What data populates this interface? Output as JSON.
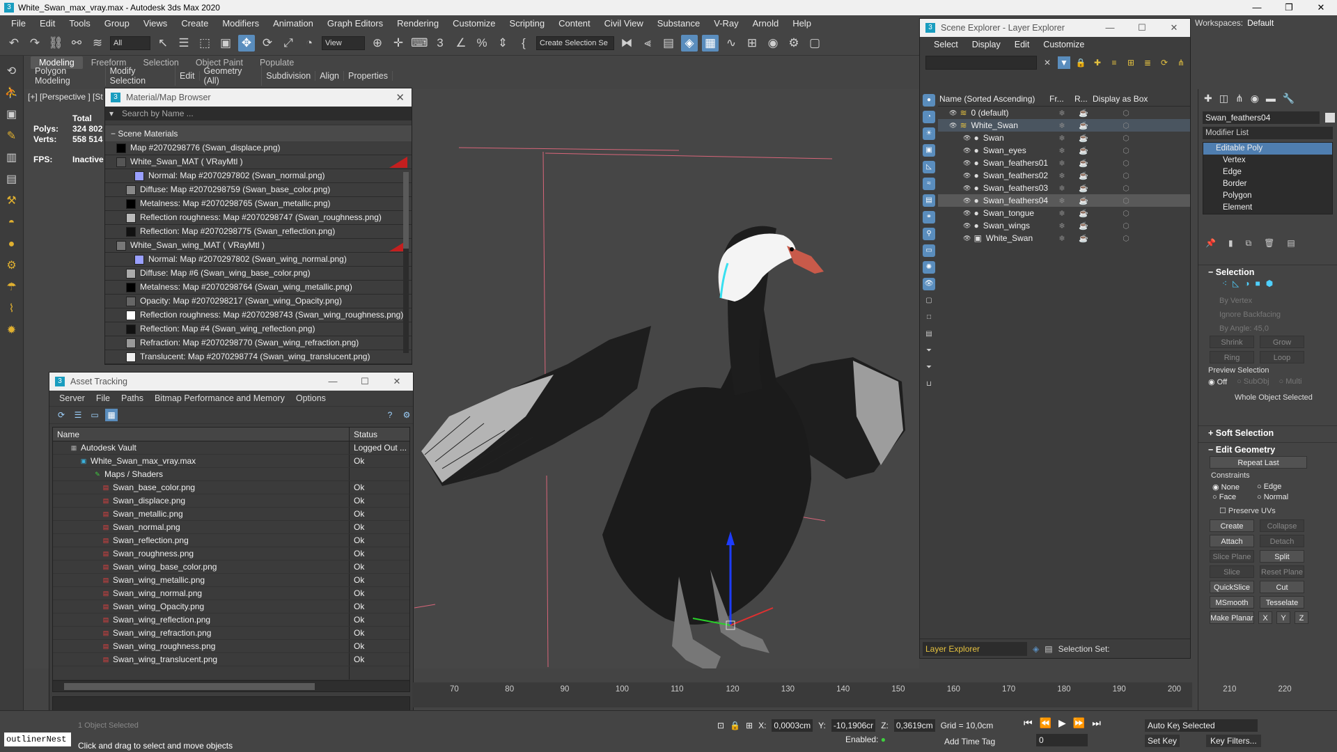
{
  "app": {
    "title": "White_Swan_max_vray.max - Autodesk 3ds Max 2020"
  },
  "menu": [
    "File",
    "Edit",
    "Tools",
    "Group",
    "Views",
    "Create",
    "Modifiers",
    "Animation",
    "Graph Editors",
    "Rendering",
    "Customize",
    "Scripting",
    "Content",
    "Civil View",
    "Substance",
    "V-Ray",
    "Arnold",
    "Help"
  ],
  "workspace": {
    "label": "Workspaces:",
    "value": "Default"
  },
  "toolbar": {
    "filter": "All",
    "view": "View",
    "selset": "Create Selection Se"
  },
  "ribbon": {
    "tabs": [
      "Modeling",
      "Freeform",
      "Selection",
      "Object Paint",
      "Populate"
    ],
    "sub": [
      "Polygon Modeling",
      "Modify Selection",
      "Edit",
      "Geometry (All)",
      "Subdivision",
      "Align",
      "Properties"
    ]
  },
  "viewport": {
    "label": "[+] [Perspective ] [St",
    "stats": {
      "total": "Total",
      "polys_k": "Polys:",
      "polys_v": "324 802",
      "verts_k": "Verts:",
      "verts_v": "558 514",
      "fps_k": "FPS:",
      "fps_v": "Inactive"
    }
  },
  "matbrowser": {
    "title": "Material/Map Browser",
    "search": "Search by Name ...",
    "section": "Scene Materials",
    "rows": [
      {
        "text": "Map #2070298776 (Swan_displace.png)",
        "indent": 16,
        "sw": "#000000"
      },
      {
        "text": "White_Swan_MAT  ( VRayMtl )",
        "indent": 16,
        "sw": "#555",
        "red": true
      },
      {
        "text": "Normal: Map #2070297802 (Swan_normal.png)",
        "indent": 42,
        "sw": "#9aa0ff"
      },
      {
        "text": "Diffuse: Map #2070298759 (Swan_base_color.png)",
        "indent": 30,
        "sw": "#888"
      },
      {
        "text": "Metalness: Map #2070298765 (Swan_metallic.png)",
        "indent": 30,
        "sw": "#000000"
      },
      {
        "text": "Reflection roughness: Map #2070298747 (Swan_roughness.png)",
        "indent": 30,
        "sw": "#bbbbbb"
      },
      {
        "text": "Reflection: Map #2070298775 (Swan_reflection.png)",
        "indent": 30,
        "sw": "#111111"
      },
      {
        "text": "White_Swan_wing_MAT  ( VRayMtl )",
        "indent": 16,
        "sw": "#777",
        "red": true
      },
      {
        "text": "Normal: Map #2070297802 (Swan_wing_normal.png)",
        "indent": 42,
        "sw": "#9aa0ff"
      },
      {
        "text": "Diffuse: Map #6 (Swan_wing_base_color.png)",
        "indent": 30,
        "sw": "#aaaaaa"
      },
      {
        "text": "Metalness: Map #2070298764 (Swan_wing_metallic.png)",
        "indent": 30,
        "sw": "#000000"
      },
      {
        "text": "Opacity: Map #2070298217 (Swan_wing_Opacity.png)",
        "indent": 30,
        "sw": "#666666"
      },
      {
        "text": "Reflection roughness: Map #2070298743 (Swan_wing_roughness.png)",
        "indent": 30,
        "sw": "#ffffff"
      },
      {
        "text": "Reflection: Map #4 (Swan_wing_reflection.png)",
        "indent": 30,
        "sw": "#111111"
      },
      {
        "text": "Refraction: Map #2070298770 (Swan_wing_refraction.png)",
        "indent": 30,
        "sw": "#999999"
      },
      {
        "text": "Translucent: Map #2070298774 (Swan_wing_translucent.png)",
        "indent": 30,
        "sw": "#eeeeee"
      }
    ]
  },
  "asset": {
    "title": "Asset Tracking",
    "menu": [
      "Server",
      "File",
      "Paths",
      "Bitmap Performance and Memory",
      "Options"
    ],
    "col_name": "Name",
    "col_status": "Status",
    "rows": [
      {
        "name": "Autodesk Vault",
        "status": "Logged Out ...",
        "indent": 24,
        "icon": "vault"
      },
      {
        "name": "White_Swan_max_vray.max",
        "status": "Ok",
        "indent": 38,
        "icon": "max"
      },
      {
        "name": "Maps / Shaders",
        "status": "",
        "indent": 58,
        "icon": "maps"
      },
      {
        "name": "Swan_base_color.png",
        "status": "Ok",
        "indent": 70,
        "icon": "png"
      },
      {
        "name": "Swan_displace.png",
        "status": "Ok",
        "indent": 70,
        "icon": "png"
      },
      {
        "name": "Swan_metallic.png",
        "status": "Ok",
        "indent": 70,
        "icon": "png"
      },
      {
        "name": "Swan_normal.png",
        "status": "Ok",
        "indent": 70,
        "icon": "png"
      },
      {
        "name": "Swan_reflection.png",
        "status": "Ok",
        "indent": 70,
        "icon": "png"
      },
      {
        "name": "Swan_roughness.png",
        "status": "Ok",
        "indent": 70,
        "icon": "png"
      },
      {
        "name": "Swan_wing_base_color.png",
        "status": "Ok",
        "indent": 70,
        "icon": "png"
      },
      {
        "name": "Swan_wing_metallic.png",
        "status": "Ok",
        "indent": 70,
        "icon": "png"
      },
      {
        "name": "Swan_wing_normal.png",
        "status": "Ok",
        "indent": 70,
        "icon": "png"
      },
      {
        "name": "Swan_wing_Opacity.png",
        "status": "Ok",
        "indent": 70,
        "icon": "png"
      },
      {
        "name": "Swan_wing_reflection.png",
        "status": "Ok",
        "indent": 70,
        "icon": "png"
      },
      {
        "name": "Swan_wing_refraction.png",
        "status": "Ok",
        "indent": 70,
        "icon": "png"
      },
      {
        "name": "Swan_wing_roughness.png",
        "status": "Ok",
        "indent": 70,
        "icon": "png"
      },
      {
        "name": "Swan_wing_translucent.png",
        "status": "Ok",
        "indent": 70,
        "icon": "png"
      }
    ]
  },
  "scene_explorer": {
    "title": "Scene Explorer - Layer Explorer",
    "menu": [
      "Select",
      "Display",
      "Edit",
      "Customize"
    ],
    "col_name": "Name (Sorted Ascending)",
    "col_fr": "Fr...",
    "col_r": "R...",
    "col_box": "Display as Box",
    "rows": [
      {
        "name": "0 (default)",
        "indent": 16,
        "type": "layer"
      },
      {
        "name": "White_Swan",
        "indent": 16,
        "type": "layer-open"
      },
      {
        "name": "Swan",
        "indent": 36,
        "type": "obj"
      },
      {
        "name": "Swan_eyes",
        "indent": 36,
        "type": "obj"
      },
      {
        "name": "Swan_feathers01",
        "indent": 36,
        "type": "obj"
      },
      {
        "name": "Swan_feathers02",
        "indent": 36,
        "type": "obj"
      },
      {
        "name": "Swan_feathers03",
        "indent": 36,
        "type": "obj"
      },
      {
        "name": "Swan_feathers04",
        "indent": 36,
        "type": "obj",
        "selected": true
      },
      {
        "name": "Swan_tongue",
        "indent": 36,
        "type": "obj"
      },
      {
        "name": "Swan_wings",
        "indent": 36,
        "type": "obj"
      },
      {
        "name": "White_Swan",
        "indent": 36,
        "type": "grp"
      }
    ],
    "bottom_dd": "Layer Explorer",
    "selset_label": "Selection Set:"
  },
  "command": {
    "object": "Swan_feathers04",
    "modlist": "Modifier List",
    "stack": [
      {
        "label": "Editable Poly",
        "sel": true
      },
      {
        "label": "Vertex"
      },
      {
        "label": "Edge"
      },
      {
        "label": "Border"
      },
      {
        "label": "Polygon"
      },
      {
        "label": "Element"
      }
    ],
    "selection": "Selection",
    "by_vertex": "By Vertex",
    "ignore_bf": "Ignore Backfacing",
    "by_angle": "By Angle:",
    "angle": "45,0",
    "shrink": "Shrink",
    "grow": "Grow",
    "ring": "Ring",
    "loop": "Loop",
    "preview": "Preview Selection",
    "off": "Off",
    "subobj": "SubObj",
    "multi": "Multi",
    "whole": "Whole Object Selected",
    "soft": "Soft Selection",
    "editgeo": "Edit Geometry",
    "repeat": "Repeat Last",
    "constraints": "Constraints",
    "c_none": "None",
    "c_edge": "Edge",
    "c_face": "Face",
    "c_normal": "Normal",
    "preserve": "Preserve UVs",
    "create": "Create",
    "collapse": "Collapse",
    "attach": "Attach",
    "detach": "Detach",
    "sliceplane": "Slice Plane",
    "split": "Split",
    "slice": "Slice",
    "resetplane": "Reset Plane",
    "quickslice": "QuickSlice",
    "cut": "Cut",
    "msmooth": "MSmooth",
    "tesselate": "Tesselate",
    "makeplanar": "Make Planar",
    "x": "X",
    "y": "Y",
    "z": "Z"
  },
  "timeline": {
    "ticks": [
      "70",
      "80",
      "90",
      "100",
      "110",
      "120",
      "130",
      "140",
      "150",
      "160",
      "170",
      "180",
      "190",
      "200",
      "210",
      "220"
    ]
  },
  "status": {
    "maxscript": "outlinerNest",
    "selected": "1 Object Selected",
    "msg": "Click and drag to select and move objects",
    "x_label": "X:",
    "x": "0,0003cm",
    "y_label": "Y:",
    "y": "-10,1906cr",
    "z_label": "Z:",
    "z": "0,3619cm",
    "grid": "Grid = 10,0cm",
    "enabled": "Enabled:",
    "addtime": "Add Time Tag",
    "frame": "0",
    "autokey": "Auto Key",
    "setkey": "Set Key",
    "selected_dd": "Selected",
    "keyfilters": "Key Filters..."
  },
  "colors": {
    "accent": "#5a8dbd",
    "selection": "#4f7eb0",
    "background": "#444444"
  }
}
